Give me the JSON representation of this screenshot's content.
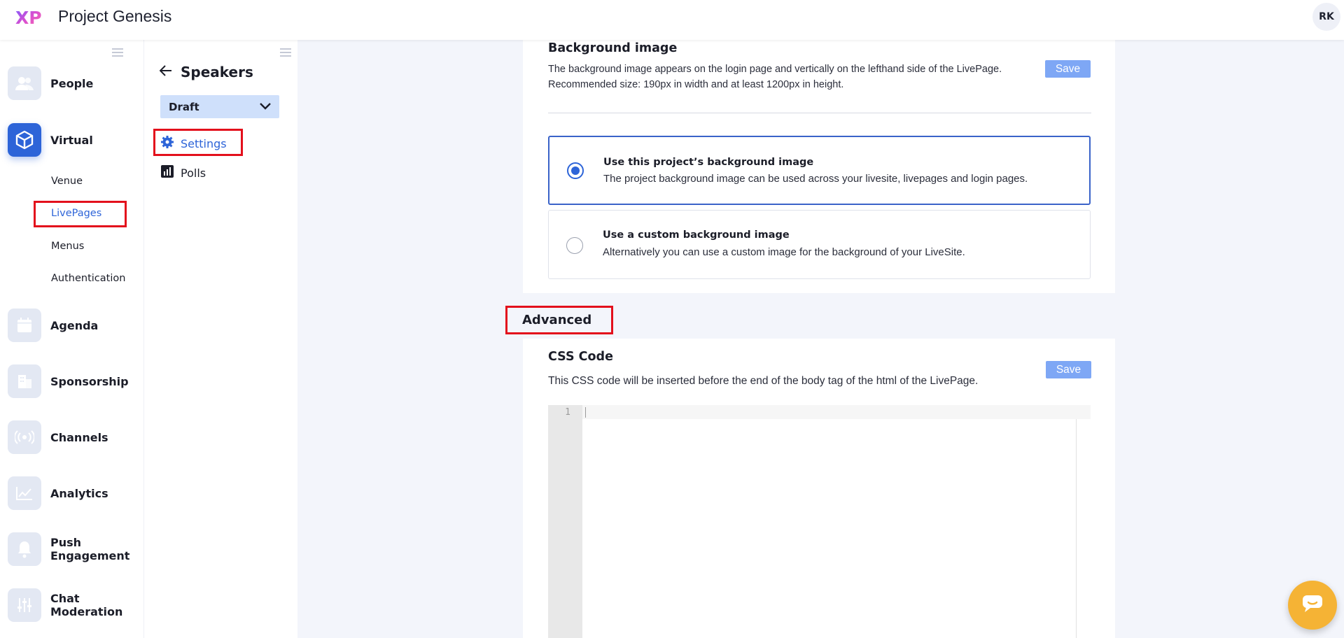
{
  "header": {
    "logo_text": "XP",
    "app_title": "Project Genesis",
    "user_initials": "RK"
  },
  "nav": {
    "items": [
      {
        "label": "People",
        "icon": "people-icon"
      },
      {
        "label": "Virtual",
        "icon": "cube-icon"
      },
      {
        "label": "Agenda",
        "icon": "calendar-icon"
      },
      {
        "label": "Sponsorship",
        "icon": "building-icon"
      },
      {
        "label": "Channels",
        "icon": "broadcast-icon"
      },
      {
        "label": "Analytics",
        "icon": "chart-icon"
      },
      {
        "label": "Push Engagement",
        "icon": "bell-icon"
      },
      {
        "label": "Chat Moderation",
        "icon": "sliders-icon"
      }
    ],
    "virtual_sub": [
      "Venue",
      "LivePages",
      "Menus",
      "Authentication"
    ],
    "active_sub": "LivePages"
  },
  "subpanel": {
    "title": "Speakers",
    "status_select": "Draft",
    "links": [
      {
        "label": "Settings",
        "icon": "gear-icon",
        "active": true
      },
      {
        "label": "Polls",
        "icon": "poll-icon",
        "active": false
      }
    ]
  },
  "background_card": {
    "title": "Background image",
    "desc_line1": "The background image appears on the login page and vertically on the lefthand side of the LivePage.",
    "desc_line2": "Recommended size: 190px in width and at least 1200px in height.",
    "save_label": "Save",
    "options": [
      {
        "title": "Use this project’s background image",
        "desc": "The project background image can be used across your livesite, livepages and login pages.",
        "selected": true
      },
      {
        "title": "Use a custom background image",
        "desc": "Alternatively you can use a custom image for the background of your LiveSite.",
        "selected": false
      }
    ]
  },
  "advanced": {
    "heading": "Advanced",
    "css_title": "CSS Code",
    "css_desc": "This CSS code will be inserted before the end of the body tag of the html of the LivePage.",
    "save_label": "Save",
    "editor_line_number": "1"
  },
  "colors": {
    "accent": "#2d64d8",
    "save_button": "#7ea7f5",
    "highlight": "#e3101c",
    "chat_bubble": "#f5b335"
  }
}
